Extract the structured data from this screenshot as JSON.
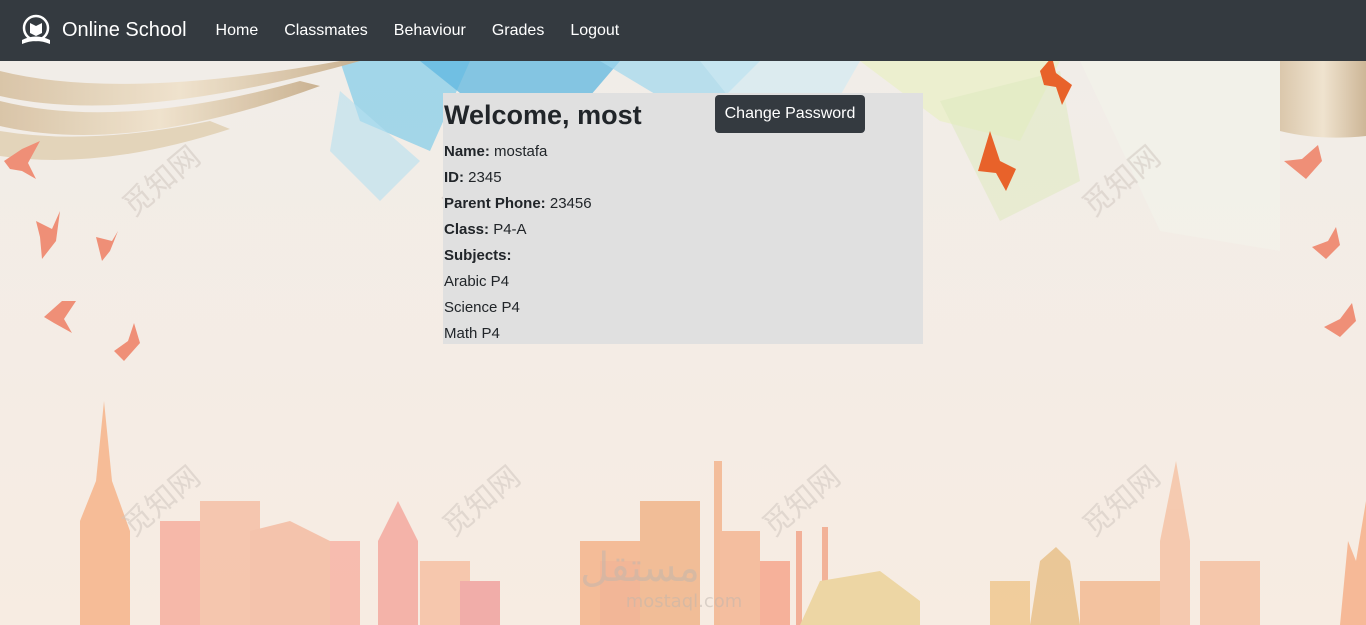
{
  "nav": {
    "brand": "Online School",
    "links": [
      "Home",
      "Classmates",
      "Behaviour",
      "Grades",
      "Logout"
    ]
  },
  "profile": {
    "welcome_prefix": "Welcome,",
    "user": "most",
    "change_password_label": "Change Password",
    "name_label": "Name:",
    "name": "mostafa",
    "id_label": "ID:",
    "id": "2345",
    "parent_phone_label": "Parent Phone:",
    "parent_phone": "23456",
    "class_label": "Class:",
    "class": "P4-A",
    "subjects_label": "Subjects:",
    "subjects": [
      "Arabic P4",
      "Science P4",
      "Math P4"
    ]
  },
  "watermark": {
    "chars": "觅知网",
    "brand_ar": "مستقل",
    "brand_url": "mostaql.com"
  },
  "colors": {
    "navbar": "#343a40",
    "card": "#e0e0e0",
    "button": "#343a40",
    "bird_orange": "#e8622a",
    "bird_salmon": "#ef8f77"
  }
}
